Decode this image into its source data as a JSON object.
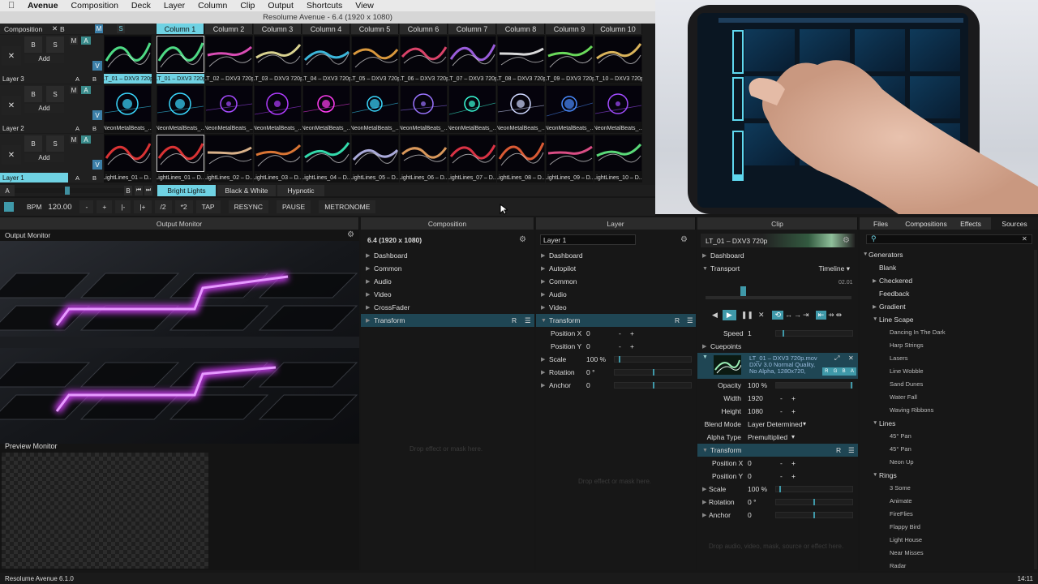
{
  "menubar": {
    "app": "Avenue",
    "items": [
      "Composition",
      "Deck",
      "Layer",
      "Column",
      "Clip",
      "Output",
      "Shortcuts",
      "View"
    ]
  },
  "window": {
    "title": "Resolume Avenue - 6.4 (1920 x 1080)"
  },
  "composition_header": {
    "label": "Composition",
    "x_label": "✕",
    "b_label": "B",
    "m_label": "M",
    "s_label": "S"
  },
  "columns": [
    "Column 1",
    "Column 2",
    "Column 3",
    "Column 4",
    "Column 5",
    "Column 6",
    "Column 7",
    "Column 8",
    "Column 9",
    "Column 10"
  ],
  "active_column": 0,
  "layers": [
    {
      "name": "Layer 3",
      "x": "✕",
      "b": "B",
      "s": "S",
      "add": "Add",
      "m": "M",
      "a_btn": "A",
      "v": "V",
      "ab": [
        "A",
        "B"
      ],
      "preview_label": "LT_01 – DXV3 720p",
      "clips": [
        "LT_01 – DXV3 720p",
        "LT_02 – DXV3 720p",
        "LT_03 – DXV3 720p",
        "LT_04 – DXV3 720p",
        "LT_05 – DXV3 720p",
        "LT_06 – DXV3 720p",
        "LT_07 – DXV3 720p",
        "LT_08 – DXV3 720p",
        "LT_09 – DXV3 720p",
        "LT_10 – DXV3 720p"
      ],
      "selected": 0,
      "active": false
    },
    {
      "name": "Layer 2",
      "x": "✕",
      "b": "B",
      "s": "S",
      "add": "Add",
      "m": "M",
      "a_btn": "A",
      "v": "V",
      "ab": [
        "A",
        "B"
      ],
      "preview_label": "NeonMetalBeats_...",
      "clips": [
        "NeonMetalBeats_...",
        "NeonMetalBeats_...",
        "NeonMetalBeats_...",
        "NeonMetalBeats_...",
        "NeonMetalBeats_...",
        "NeonMetalBeats_...",
        "NeonMetalBeats_...",
        "NeonMetalBeats_...",
        "NeonMetalBeats_...",
        "NeonMetalBeats_..."
      ],
      "selected": -1,
      "active": false
    },
    {
      "name": "Layer 1",
      "x": "✕",
      "b": "B",
      "s": "S",
      "add": "Add",
      "m": "M",
      "a_btn": "A",
      "v": "V",
      "ab": [
        "A",
        "B"
      ],
      "preview_label": "LightLines_01 – D...",
      "clips": [
        "LightLines_01 – D...",
        "LightLines_02 – D...",
        "LightLines_03 – D...",
        "LightLines_04 – D...",
        "LightLines_05 – D...",
        "LightLines_06 – D...",
        "LightLines_07 – D...",
        "LightLines_08 – D...",
        "LightLines_09 – D...",
        "LightLines_10 – D..."
      ],
      "selected": -1,
      "active": true
    }
  ],
  "crossfader": {
    "a": "A",
    "b": "B",
    "prev": "⏮",
    "next": "⏭"
  },
  "deck_tabs": [
    "Bright Lights",
    "Black & White",
    "Hypnotic"
  ],
  "active_deck": 0,
  "bpm": {
    "label": "BPM",
    "value": "120.00",
    "minus": "-",
    "plus": "+",
    "nudge_minus": "|-",
    "nudge_plus": "|+",
    "half": "/2",
    "double": "*2",
    "tap": "TAP",
    "resync": "RESYNC",
    "pause": "PAUSE",
    "metronome": "METRONOME"
  },
  "panel_headers": {
    "output_monitor": "Output Monitor",
    "composition": "Composition",
    "layer": "Layer",
    "clip": "Clip"
  },
  "output": {
    "label": "Output Monitor",
    "preview_label": "Preview Monitor"
  },
  "composition_panel": {
    "title": "6.4 (1920 x 1080)",
    "items": [
      "Dashboard",
      "Common",
      "Audio",
      "Video",
      "CrossFader",
      "Transform"
    ],
    "highlight": "Transform",
    "r_label": "R",
    "drop_hint": "Drop effect or mask here."
  },
  "layer_panel": {
    "name_value": "Layer 1",
    "items": [
      "Dashboard",
      "Autopilot",
      "Common",
      "Audio",
      "Video",
      "Transform"
    ],
    "highlight": "Transform",
    "r_label": "R",
    "props": [
      {
        "label": "Position X",
        "value": "0",
        "kind": "pm"
      },
      {
        "label": "Position Y",
        "value": "0",
        "kind": "pm"
      },
      {
        "label": "Scale",
        "value": "100 %",
        "kind": "slider",
        "level": 0.05
      },
      {
        "label": "Rotation",
        "value": "0 °",
        "kind": "slider",
        "level": 0.5
      },
      {
        "label": "Anchor",
        "value": "0",
        "kind": "slider",
        "level": 0.5
      }
    ],
    "drop_hint": "Drop effect or mask here."
  },
  "clip_panel": {
    "name": "LT_01 – DXV3 720p",
    "dashboard": "Dashboard",
    "transport": "Transport",
    "transport_mode": "Timeline",
    "time": "02.01",
    "speed_label": "Speed",
    "speed_value": "1",
    "cuepoints": "Cuepoints",
    "file_line1": "LT_01 – DXV3 720p.mov",
    "file_line2": "DXV 3.0 Normal Quality,",
    "file_line3": "No Alpha, 1280x720,",
    "rgba": [
      "R",
      "G",
      "B",
      "A"
    ],
    "props": [
      {
        "label": "Opacity",
        "value": "100 %"
      },
      {
        "label": "Width",
        "value": "1920"
      },
      {
        "label": "Height",
        "value": "1080"
      },
      {
        "label": "Blend Mode",
        "value": "Layer Determined"
      },
      {
        "label": "Alpha Type",
        "value": "Premultiplied"
      }
    ],
    "transform": "Transform",
    "r_label": "R",
    "tprops": [
      {
        "label": "Position X",
        "value": "0"
      },
      {
        "label": "Position Y",
        "value": "0"
      },
      {
        "label": "Scale",
        "value": "100 %"
      },
      {
        "label": "Rotation",
        "value": "0 °"
      },
      {
        "label": "Anchor",
        "value": "0"
      }
    ],
    "drop_hint": "Drop audio, video, mask, source or effect here."
  },
  "browser": {
    "tabs": [
      "Files",
      "Compositions",
      "Effects",
      "Sources"
    ],
    "active_tab": 3,
    "tree": [
      {
        "label": "Generators",
        "level": 0,
        "open": true
      },
      {
        "label": "Blank",
        "level": 1
      },
      {
        "label": "Checkered",
        "level": 1,
        "arrow": true
      },
      {
        "label": "Feedback",
        "level": 1
      },
      {
        "label": "Gradient",
        "level": 1,
        "arrow": true
      },
      {
        "label": "Line Scape",
        "level": 1,
        "open": true
      },
      {
        "label": "Dancing In The Dark",
        "level": 2
      },
      {
        "label": "Harp Strings",
        "level": 2
      },
      {
        "label": "Lasers",
        "level": 2
      },
      {
        "label": "Line Wobble",
        "level": 2
      },
      {
        "label": "Sand Dunes",
        "level": 2
      },
      {
        "label": "Water Fall",
        "level": 2
      },
      {
        "label": "Waving Ribbons",
        "level": 2
      },
      {
        "label": "Lines",
        "level": 1,
        "open": true
      },
      {
        "label": "45° Pan",
        "level": 2
      },
      {
        "label": "45° Pan",
        "level": 2
      },
      {
        "label": "Neon Up",
        "level": 2
      },
      {
        "label": "Rings",
        "level": 1,
        "open": true
      },
      {
        "label": "3 Some",
        "level": 2
      },
      {
        "label": "Animate",
        "level": 2
      },
      {
        "label": "FireFlies",
        "level": 2
      },
      {
        "label": "Flappy Bird",
        "level": 2
      },
      {
        "label": "Light House",
        "level": 2
      },
      {
        "label": "Near Misses",
        "level": 2
      },
      {
        "label": "Radar",
        "level": 2
      }
    ]
  },
  "status": {
    "left": "Resolume Avenue 6.1.0",
    "right": "14:11"
  },
  "colors": {
    "accent": "#6fd2e3",
    "highlight_row": "#1f4654",
    "teal": "#3a8b8b",
    "blue": "#3c7fa8",
    "neon": "#c23be6"
  }
}
